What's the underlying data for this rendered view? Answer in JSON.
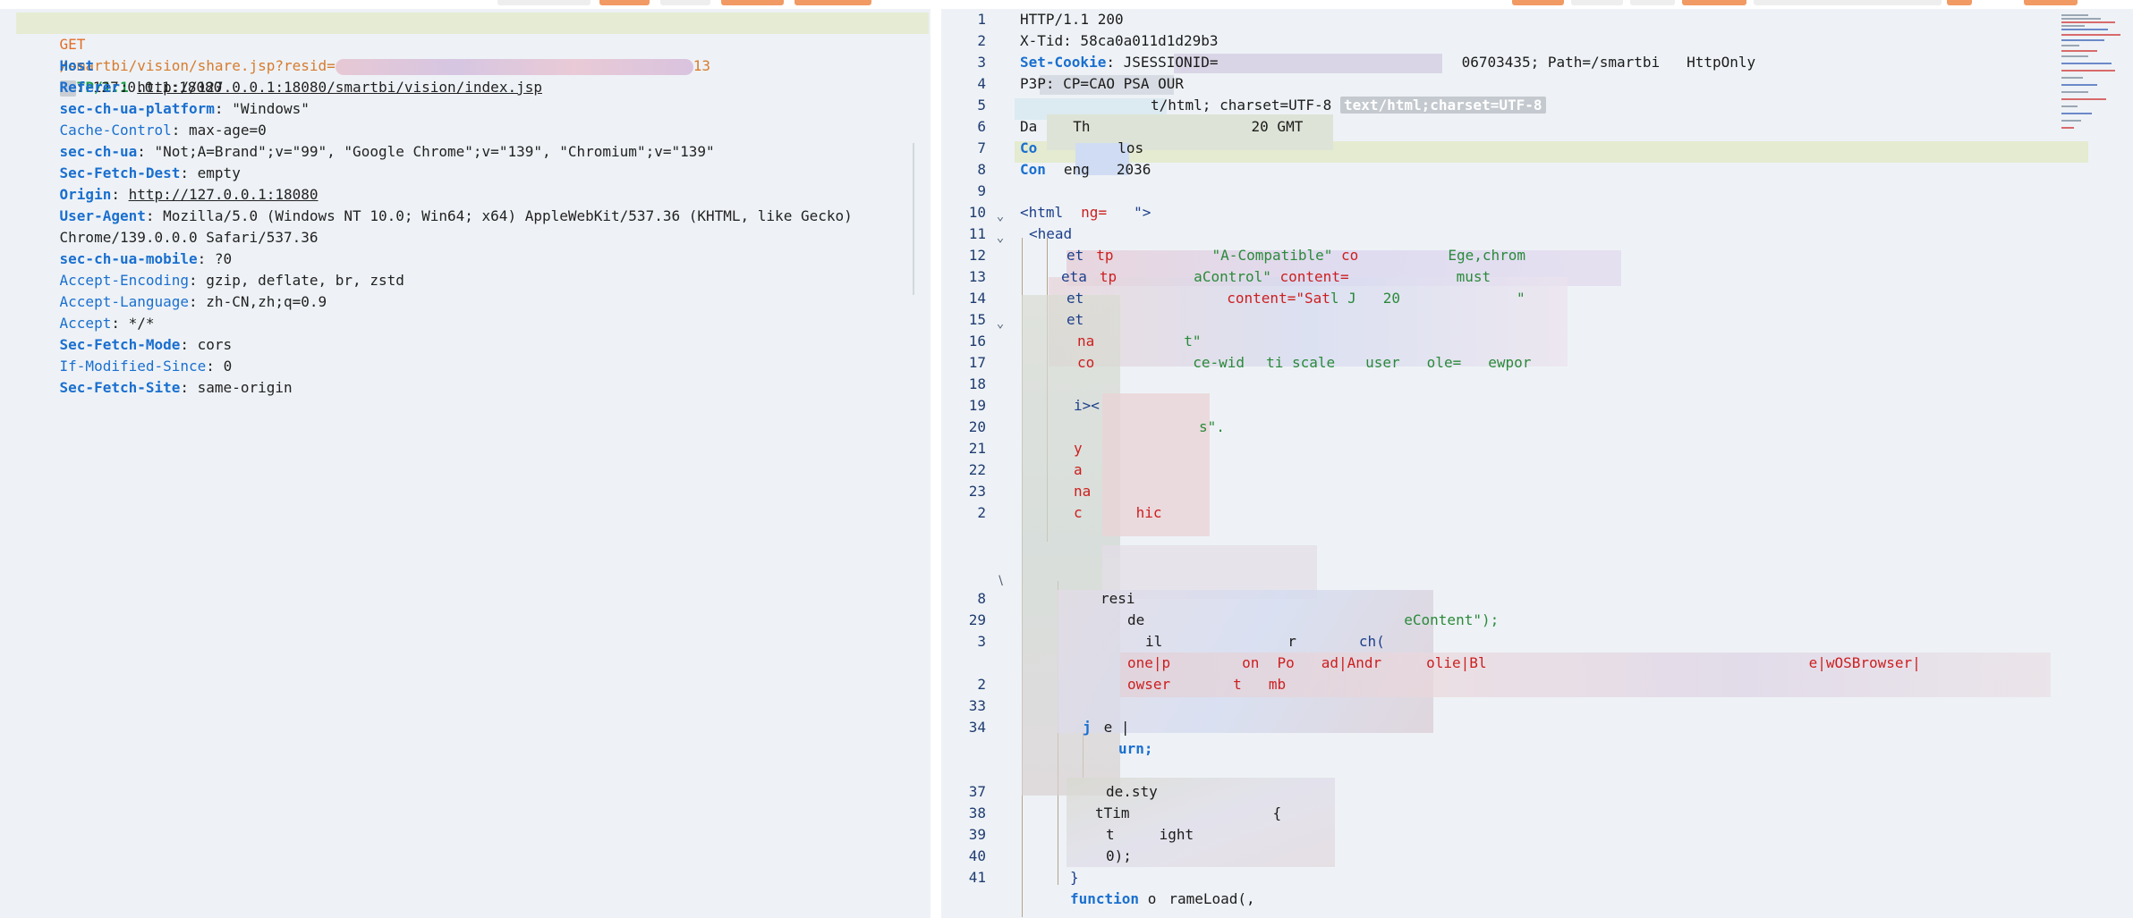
{
  "request": {
    "request_line": {
      "method": "GET",
      "path": "/smartbi/vision/share.jsp?resid=",
      "tail": "13",
      "protocol": "HTTP/1.1"
    },
    "headers": [
      {
        "name": "Host",
        "value": ": 127.0.0.1:18080"
      },
      {
        "name": "Referer",
        "value": "http://127.0.0.1:18080/smartbi/vision/index.jsp"
      },
      {
        "name": "sec-ch-ua-platform",
        "value": "\"Windows\""
      },
      {
        "name": "Cache-Control",
        "value": "max-age=0"
      },
      {
        "name": "sec-ch-ua",
        "value": "\"Not;A=Brand\";v=\"99\", \"Google Chrome\";v=\"139\", \"Chromium\";v=\"139\""
      },
      {
        "name": "Sec-Fetch-Dest",
        "value": "empty"
      },
      {
        "name": "Origin",
        "value": "http://127.0.0.1:18080"
      },
      {
        "name": "User-Agent",
        "value": "Mozilla/5.0 (Windows NT 10.0; Win64; x64) AppleWebKit/537.36 (KHTML, like Gecko)",
        "value_cont": "Chrome/139.0.0.0 Safari/537.36"
      },
      {
        "name": "sec-ch-ua-mobile",
        "value": "?0"
      },
      {
        "name": "Accept-Encoding",
        "value": "gzip, deflate, br, zstd"
      },
      {
        "name": "Accept-Language",
        "value": "zh-CN,zh;q=0.9"
      },
      {
        "name": "Accept",
        "value": "*/*"
      },
      {
        "name": "Sec-Fetch-Mode",
        "value": "cors"
      },
      {
        "name": "If-Modified-Since",
        "value": "0"
      },
      {
        "name": "Sec-Fetch-Site",
        "value": "same-origin"
      }
    ]
  },
  "response": {
    "line_numbers": [
      "1",
      "2",
      "3",
      "4",
      "5",
      "6",
      "7",
      "8",
      "9",
      "10",
      "11",
      "12",
      "13",
      "14",
      "15",
      "16",
      "17",
      "18",
      "19",
      "20",
      "21",
      "22",
      "23",
      "2",
      "",
      "",
      "",
      "8",
      "29",
      "3",
      "",
      "2",
      "33",
      "34",
      "",
      "",
      "37",
      "38",
      "39",
      "40",
      "41"
    ],
    "lines": {
      "l1": "HTTP/1.1 200",
      "l2": "X-Tid: 58ca0a011d1d29b3",
      "l3_name": "Set-Cookie",
      "l3_a": ": JSESSIONID=",
      "l3_b": "06703435; Path=/smartbi",
      "l3_c": "HttpOnly",
      "l4": "P3P: CP=CAO PSA OUR",
      "l5_a": "t/html; charset=UTF-8",
      "l5_badge": "text/html;charset=UTF-8",
      "l6_a": "Da",
      "l6_b": "Th",
      "l6_c": "20 GMT",
      "l7_name": "Co",
      "l7_a": "los",
      "l8_name": "Con",
      "l8_b": "eng",
      "l8_c": "2036",
      "l10_a": "<html",
      "l10_b": "ng=",
      "l10_c": "\">",
      "l11": "<head",
      "l12_a": "et",
      "l12_b": "tp",
      "l12_c": "\"",
      "l12_d": "A-Compatible\"",
      "l12_e": "co",
      "l12_f": "E",
      "l12_g": "ge,chrom",
      "l13_a": "eta",
      "l13_b": "tp",
      "l13_c": "a",
      "l13_d": "Control\"",
      "l13_e": "content=",
      "l13_f": "must",
      "l14_a": "et",
      "l14_b": "content=\"Sat",
      "l14_c": "l J",
      "l14_d": "20",
      "l14_e": "\"",
      "l15": "et",
      "l16_a": "na",
      "l16_b": "t\"",
      "l17_a": "co",
      "l17_b": "ce-wid",
      "l17_c": "ti",
      "l17_d": "scale",
      "l17_e": "user",
      "l17_f": "ole=",
      "l17_g": "ewpor",
      "l19": "i",
      "l19_b": "><",
      "l20_a": "s\".",
      "l21": "y",
      "l22": "a",
      "l23": "na",
      "l24_a": "c",
      "l24_b": "hic",
      "l28": "resi",
      "l29_a": "de",
      "l29_b": "eContent\");",
      "l30_a": "il",
      "l30_b": "r",
      "l30_c": "ch(",
      "l31_a": "one|p",
      "l31_b": "on",
      "l31_c": "Po",
      "l31_d": "ad|Andr",
      "l31_e": "olie|Bl",
      "l31_f": "e|wOSBrowser|",
      "l32_a": "owser",
      "l32_b": "t",
      "l32_c": "mb",
      "l33_a": "j",
      "l33_b": "e |",
      "l34": "urn;",
      "l36_a": "de.sty",
      "l37_a": "tTim",
      "l37_b": "{",
      "l38_a": "t",
      "l38_b": "ight",
      "l39": "0);",
      "l40": "}",
      "l41_kw": "function",
      "l41_a": "o",
      "l41_b": "rameLoad(,"
    }
  },
  "colors": {
    "pane_bg": "#eef2f6",
    "header_name": "#1a6fcf",
    "method": "#e26d28",
    "protocol": "#1a9d4a",
    "line_highlight": "#e4ebd0",
    "tag": "#1d3f8a",
    "attr": "#cc1f1f",
    "accent_orange": "#f29a63"
  }
}
